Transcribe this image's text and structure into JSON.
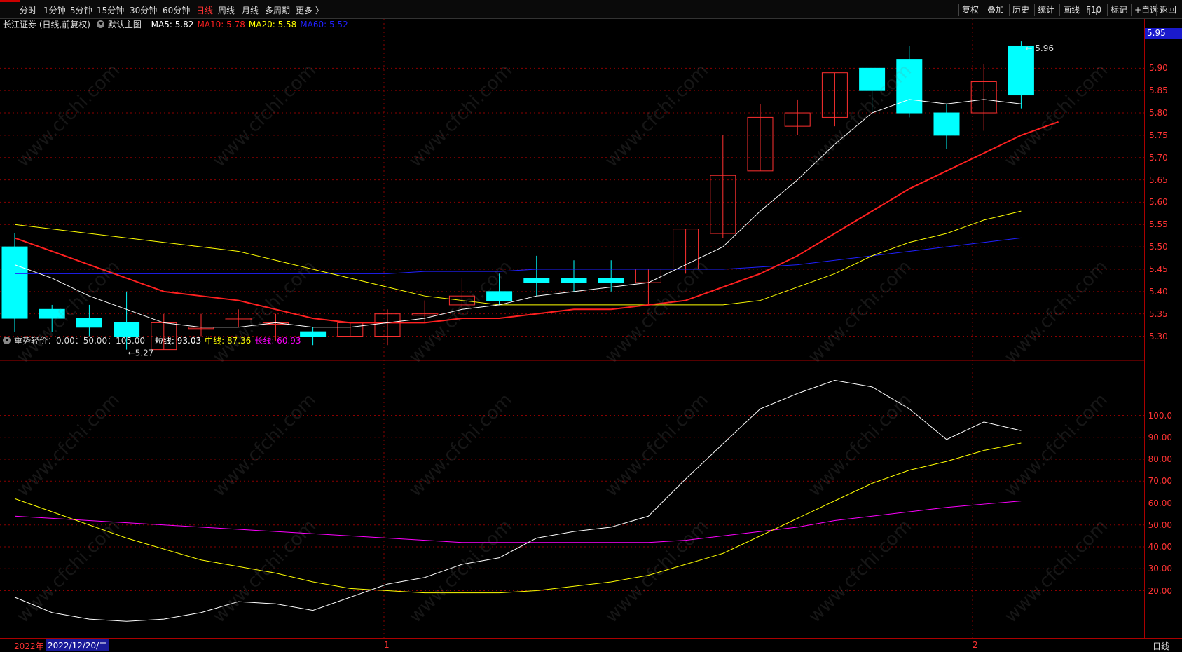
{
  "toolbar": {
    "periods": [
      "分时",
      "1分钟",
      "5分钟",
      "15分钟",
      "30分钟",
      "60分钟",
      "日线",
      "周线",
      "月线",
      "多周期",
      "更多 〉"
    ],
    "active_period": "日线",
    "right_buttons": [
      "复权",
      "叠加",
      "历史",
      "统计",
      "画线",
      "F10",
      "标记",
      "+自选",
      "返回"
    ]
  },
  "main_legend": {
    "title": "长江证券 (日线,前复权)",
    "main_chart": "默认主图",
    "ma": [
      {
        "label": "MA5: 5.82",
        "color": "#ffffff"
      },
      {
        "label": "MA10: 5.78",
        "color": "#ff2020"
      },
      {
        "label": "MA20: 5.58",
        "color": "#ffff00"
      },
      {
        "label": "MA60: 5.52",
        "color": "#2020ff"
      }
    ]
  },
  "sub_legend": {
    "title": "重势轻价：0.00：50.00：105.00",
    "lines": [
      {
        "label": "短线: 93.03",
        "color": "#ffffff"
      },
      {
        "label": "中线: 87.36",
        "color": "#ffff00"
      },
      {
        "label": "长线: 60.93",
        "color": "#ff00ff"
      }
    ]
  },
  "price_axis": {
    "labels": [
      "5.90",
      "5.85",
      "5.80",
      "5.75",
      "5.70",
      "5.65",
      "5.60",
      "5.55",
      "5.50",
      "5.45",
      "5.40",
      "5.35",
      "5.30"
    ],
    "current_price": "5.95"
  },
  "indicator_axis": {
    "labels": [
      "100.0",
      "90.00",
      "80.00",
      "70.00",
      "60.00",
      "50.00",
      "40.00",
      "30.00",
      "20.00"
    ]
  },
  "annotations": {
    "high": "5.96",
    "low": "5.27"
  },
  "bottom": {
    "year": "2022年",
    "date_cursor": "2022/12/20/二",
    "month_1": "1",
    "month_2": "2",
    "period_label": "日线"
  },
  "watermark_text": "www.cfchi.com",
  "colors": {
    "up": "#ff3030",
    "down": "#00ffff",
    "ma5": "#ffffff",
    "ma10": "#ff2020",
    "ma20": "#ffff00",
    "ma60": "#2020ff",
    "grid": "#8b0000"
  },
  "chart_data": {
    "type": "candlestick",
    "candles": [
      {
        "o": 5.5,
        "h": 5.53,
        "l": 5.31,
        "c": 5.34
      },
      {
        "o": 5.36,
        "h": 5.37,
        "l": 5.31,
        "c": 5.34
      },
      {
        "o": 5.34,
        "h": 5.37,
        "l": 5.3,
        "c": 5.32
      },
      {
        "o": 5.33,
        "h": 5.4,
        "l": 5.27,
        "c": 5.3
      },
      {
        "o": 5.27,
        "h": 5.35,
        "l": 5.27,
        "c": 5.33
      },
      {
        "o": 5.32,
        "h": 5.35,
        "l": 5.3,
        "c": 5.32
      },
      {
        "o": 5.34,
        "h": 5.36,
        "l": 5.32,
        "c": 5.34
      },
      {
        "o": 5.33,
        "h": 5.35,
        "l": 5.29,
        "c": 5.33
      },
      {
        "o": 5.31,
        "h": 5.32,
        "l": 5.28,
        "c": 5.3
      },
      {
        "o": 5.3,
        "h": 5.33,
        "l": 5.3,
        "c": 5.33
      },
      {
        "o": 5.3,
        "h": 5.36,
        "l": 5.28,
        "c": 5.35
      },
      {
        "o": 5.35,
        "h": 5.38,
        "l": 5.33,
        "c": 5.35
      },
      {
        "o": 5.37,
        "h": 5.43,
        "l": 5.36,
        "c": 5.39
      },
      {
        "o": 5.4,
        "h": 5.44,
        "l": 5.37,
        "c": 5.38
      },
      {
        "o": 5.43,
        "h": 5.48,
        "l": 5.39,
        "c": 5.42
      },
      {
        "o": 5.43,
        "h": 5.47,
        "l": 5.4,
        "c": 5.42
      },
      {
        "o": 5.43,
        "h": 5.47,
        "l": 5.4,
        "c": 5.42
      },
      {
        "o": 5.42,
        "h": 5.45,
        "l": 5.37,
        "c": 5.45
      },
      {
        "o": 5.45,
        "h": 5.54,
        "l": 5.44,
        "c": 5.54
      },
      {
        "o": 5.53,
        "h": 5.75,
        "l": 5.52,
        "c": 5.66
      },
      {
        "o": 5.67,
        "h": 5.82,
        "l": 5.67,
        "c": 5.79
      },
      {
        "o": 5.77,
        "h": 5.83,
        "l": 5.75,
        "c": 5.8
      },
      {
        "o": 5.79,
        "h": 5.89,
        "l": 5.77,
        "c": 5.89
      },
      {
        "o": 5.9,
        "h": 5.9,
        "l": 5.8,
        "c": 5.85
      },
      {
        "o": 5.92,
        "h": 5.95,
        "l": 5.79,
        "c": 5.8
      },
      {
        "o": 5.8,
        "h": 5.82,
        "l": 5.72,
        "c": 5.75
      },
      {
        "o": 5.8,
        "h": 5.91,
        "l": 5.76,
        "c": 5.87
      },
      {
        "o": 5.95,
        "h": 5.96,
        "l": 5.81,
        "c": 5.84
      }
    ],
    "ma5": [
      5.46,
      5.43,
      5.39,
      5.36,
      5.33,
      5.32,
      5.32,
      5.33,
      5.32,
      5.32,
      5.33,
      5.34,
      5.36,
      5.37,
      5.39,
      5.4,
      5.41,
      5.42,
      5.46,
      5.5,
      5.58,
      5.65,
      5.73,
      5.8,
      5.83,
      5.82,
      5.83,
      5.82
    ],
    "ma10": [
      5.52,
      5.49,
      5.46,
      5.43,
      5.4,
      5.39,
      5.38,
      5.36,
      5.34,
      5.33,
      5.33,
      5.33,
      5.34,
      5.34,
      5.35,
      5.36,
      5.36,
      5.37,
      5.38,
      5.41,
      5.44,
      5.48,
      5.53,
      5.58,
      5.63,
      5.67,
      5.71,
      5.75,
      5.78
    ],
    "ma20": [
      5.55,
      5.54,
      5.53,
      5.52,
      5.51,
      5.5,
      5.49,
      5.47,
      5.45,
      5.43,
      5.41,
      5.39,
      5.38,
      5.37,
      5.37,
      5.37,
      5.37,
      5.37,
      5.37,
      5.37,
      5.38,
      5.41,
      5.44,
      5.48,
      5.51,
      5.53,
      5.56,
      5.58
    ],
    "ma60": [
      5.44,
      5.44,
      5.44,
      5.44,
      5.44,
      5.44,
      5.44,
      5.44,
      5.44,
      5.44,
      5.44,
      5.445,
      5.445,
      5.445,
      5.45,
      5.45,
      5.45,
      5.45,
      5.45,
      5.45,
      5.455,
      5.46,
      5.47,
      5.48,
      5.49,
      5.5,
      5.51,
      5.52
    ],
    "short": [
      17,
      10,
      7,
      6,
      7,
      10,
      15,
      14,
      11,
      17,
      23,
      26,
      32,
      35,
      44,
      47,
      49,
      54,
      71,
      87,
      103,
      110,
      116,
      113,
      103,
      89,
      97,
      93.03
    ],
    "mid": [
      62,
      56,
      50,
      44,
      39,
      34,
      31,
      28,
      24,
      21,
      20,
      19,
      19,
      19,
      20,
      22,
      24,
      27,
      32,
      37,
      45,
      53,
      61,
      69,
      75,
      79,
      84,
      87.36
    ],
    "long": [
      54,
      53,
      52,
      51,
      50,
      49,
      48,
      47,
      46,
      45,
      44,
      43,
      42,
      42,
      42,
      42,
      42,
      42,
      43,
      45,
      47,
      49,
      52,
      54,
      56,
      58,
      59.5,
      60.93
    ],
    "price_ylim": [
      5.26,
      5.99
    ],
    "ind_ylim": [
      0,
      120
    ]
  }
}
